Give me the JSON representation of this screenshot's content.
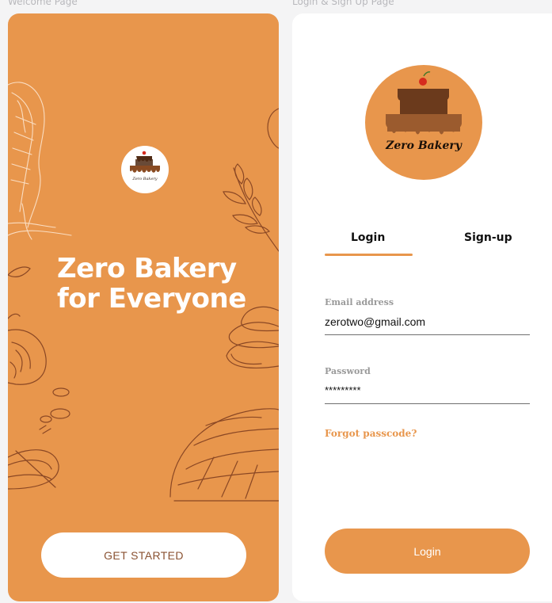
{
  "frames": {
    "welcome_label": "Welcome Page",
    "login_label": "Login & Sign Up Page"
  },
  "colors": {
    "brand_orange": "#e8964c",
    "chocolate": "#6b3a1c",
    "caramel": "#9b5b2e",
    "sketch_brown": "#7a3a1e"
  },
  "welcome": {
    "logo_text": "Zero Bakery",
    "headline_line1": "Zero Bakery",
    "headline_line2": "for Everyone",
    "get_started_label": "GET STARTED"
  },
  "login": {
    "logo_text": "Zero Bakery",
    "tabs": [
      {
        "label": "Login",
        "active": true
      },
      {
        "label": "Sign-up",
        "active": false
      }
    ],
    "email": {
      "label": "Email address",
      "value": "zerotwo@gmail.com"
    },
    "password": {
      "label": "Password",
      "value": "*********"
    },
    "forgot_label": "Forgot passcode?",
    "login_button_label": "Login"
  }
}
